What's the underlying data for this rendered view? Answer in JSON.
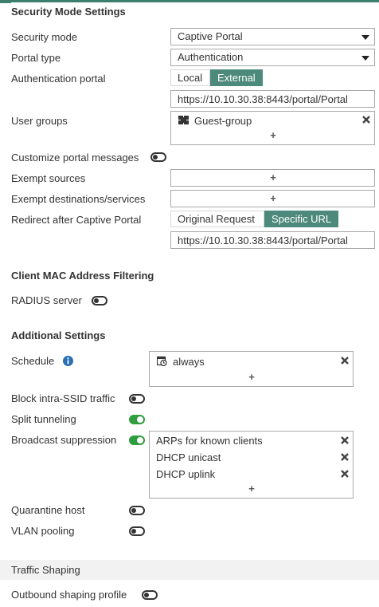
{
  "colors": {
    "accent": "#4d8a7b",
    "toggle_on": "#2e9e3e",
    "info": "#2a6fb4"
  },
  "security": {
    "heading": "Security Mode Settings",
    "security_mode": {
      "label": "Security mode",
      "value": "Captive Portal"
    },
    "portal_type": {
      "label": "Portal type",
      "value": "Authentication"
    },
    "auth_portal": {
      "label": "Authentication portal",
      "options": [
        "Local",
        "External"
      ],
      "selected": "External",
      "url": "https://10.10.30.38:8443/portal/Portal"
    },
    "user_groups": {
      "label": "User groups",
      "items": [
        "Guest-group"
      ],
      "add": "+"
    },
    "customize_messages": {
      "label": "Customize portal messages",
      "enabled": false
    },
    "exempt_sources": {
      "label": "Exempt sources",
      "add": "+"
    },
    "exempt_destinations": {
      "label": "Exempt destinations/services",
      "add": "+"
    },
    "redirect": {
      "label": "Redirect after Captive Portal",
      "options": [
        "Original Request",
        "Specific URL"
      ],
      "selected": "Specific URL",
      "url": "https://10.10.30.38:8443/portal/Portal"
    }
  },
  "mac_filter": {
    "heading": "Client MAC Address Filtering",
    "radius": {
      "label": "RADIUS server",
      "enabled": false
    }
  },
  "additional": {
    "heading": "Additional Settings",
    "schedule": {
      "label": "Schedule",
      "items": [
        "always"
      ],
      "add": "+",
      "info_icon": "info-icon"
    },
    "block_intra_ssid": {
      "label": "Block intra-SSID traffic",
      "enabled": false
    },
    "split_tunneling": {
      "label": "Split tunneling",
      "enabled": true
    },
    "broadcast_suppression": {
      "label": "Broadcast suppression",
      "enabled": true,
      "items": [
        "ARPs for known clients",
        "DHCP unicast",
        "DHCP uplink"
      ],
      "add": "+"
    },
    "quarantine_host": {
      "label": "Quarantine host",
      "enabled": false
    },
    "vlan_pooling": {
      "label": "VLAN pooling",
      "enabled": false
    }
  },
  "traffic_shaping": {
    "heading": "Traffic Shaping",
    "outbound": {
      "label": "Outbound shaping profile",
      "enabled": false
    }
  }
}
